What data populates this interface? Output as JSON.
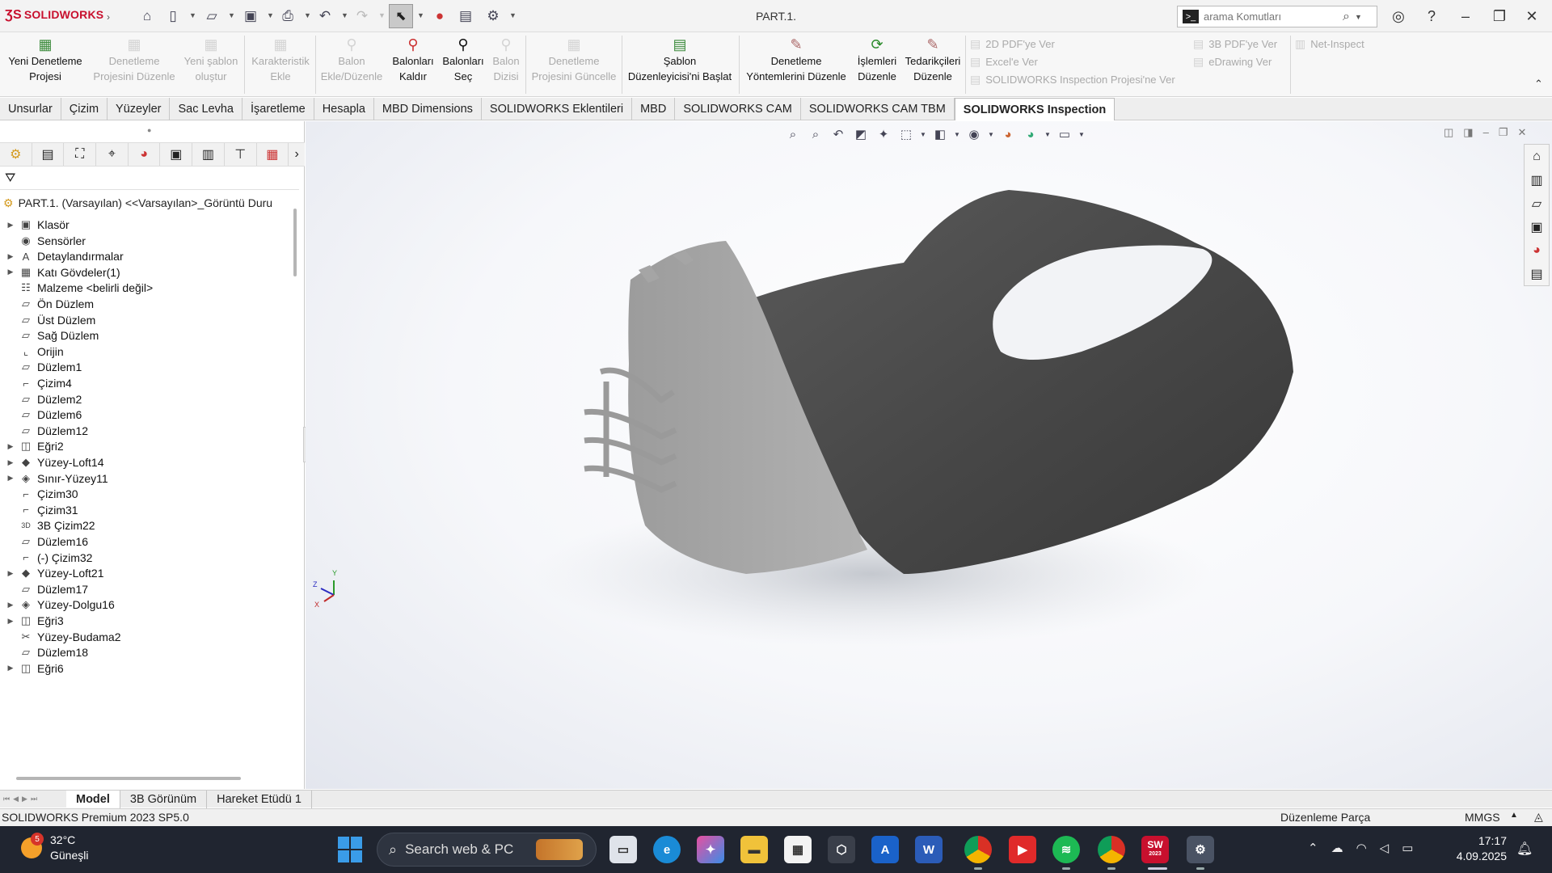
{
  "app": {
    "brand": "SOLIDWORKS",
    "doc_title": "PART.1.",
    "search_placeholder": "arama Komutları"
  },
  "ribbon": {
    "buttons": [
      {
        "label": "Yeni Denetleme Projesi",
        "l1": "Yeni Denetleme",
        "l2": "Projesi",
        "icon": "new-inspection-icon",
        "enabled": true
      },
      {
        "label": "Denetleme Projesini Düzenle",
        "l1": "Denetleme",
        "l2": "Projesini Düzenle",
        "icon": "edit-inspection-icon",
        "enabled": false
      },
      {
        "label": "Yeni şablon oluştur",
        "l1": "Yeni şablon",
        "l2": "oluştur",
        "icon": "new-template-icon",
        "enabled": false
      },
      {
        "label": "Karakteristik Ekle",
        "l1": "Karakteristik",
        "l2": "Ekle",
        "icon": "add-characteristic-icon",
        "enabled": false
      },
      {
        "label": "Balon Ekle/Düzenle",
        "l1": "Balon",
        "l2": "Ekle/Düzenle",
        "icon": "balloon-icon",
        "enabled": false
      },
      {
        "label": "Balonları Kaldır",
        "l1": "Balonları",
        "l2": "Kaldır",
        "icon": "remove-balloons-icon",
        "enabled": true
      },
      {
        "label": "Balonları Seç",
        "l1": "Balonları",
        "l2": "Seç",
        "icon": "select-balloons-icon",
        "enabled": true
      },
      {
        "label": "Balon Dizisi",
        "l1": "Balon",
        "l2": "Dizisi",
        "icon": "balloon-sequence-icon",
        "enabled": false
      },
      {
        "label": "Denetleme Projesini Güncelle",
        "l1": "Denetleme",
        "l2": "Projesini Güncelle",
        "icon": "update-inspection-icon",
        "enabled": false
      },
      {
        "label": "Şablon Düzenleyicisi'ni Başlat",
        "l1": "Şablon",
        "l2": "Düzenleyicisi'ni Başlat",
        "icon": "template-editor-icon",
        "enabled": true
      },
      {
        "label": "Denetleme Yöntemlerini Düzenle",
        "l1": "Denetleme",
        "l2": "Yöntemlerini Düzenle",
        "icon": "inspection-methods-icon",
        "enabled": true
      },
      {
        "label": "İşlemleri Düzenle",
        "l1": "İşlemleri",
        "l2": "Düzenle",
        "icon": "operations-icon",
        "enabled": true
      },
      {
        "label": "Tedarikçileri Düzenle",
        "l1": "Tedarikçileri",
        "l2": "Düzenle",
        "icon": "vendors-icon",
        "enabled": true
      }
    ],
    "exports_col1": [
      "2D PDF'ye Ver",
      "Excel'e Ver",
      "SOLIDWORKS Inspection Projesi'ne Ver"
    ],
    "exports_col2": [
      "3B PDF'ye Ver",
      "eDrawing Ver"
    ],
    "exports_col3": [
      "Net-Inspect"
    ]
  },
  "tabs": [
    {
      "label": "Unsurlar",
      "active": false
    },
    {
      "label": "Çizim",
      "active": false
    },
    {
      "label": "Yüzeyler",
      "active": false
    },
    {
      "label": "Sac Levha",
      "active": false
    },
    {
      "label": "İşaretleme",
      "active": false
    },
    {
      "label": "Hesapla",
      "active": false
    },
    {
      "label": "MBD Dimensions",
      "active": false
    },
    {
      "label": "SOLIDWORKS Eklentileri",
      "active": false
    },
    {
      "label": "MBD",
      "active": false
    },
    {
      "label": "SOLIDWORKS CAM",
      "active": false
    },
    {
      "label": "SOLIDWORKS CAM TBM",
      "active": false
    },
    {
      "label": "SOLIDWORKS Inspection",
      "active": true
    }
  ],
  "tree": {
    "root": "PART.1. (Varsayılan) <<Varsayılan>_Görüntü Duru",
    "items": [
      {
        "label": "Klasör",
        "expandable": true,
        "icon": "folder-icon"
      },
      {
        "label": "Sensörler",
        "expandable": false,
        "icon": "sensor-icon"
      },
      {
        "label": "Detaylandırmalar",
        "expandable": true,
        "icon": "annotation-icon"
      },
      {
        "label": "Katı Gövdeler(1)",
        "expandable": true,
        "icon": "solid-body-icon"
      },
      {
        "label": "Malzeme <belirli değil>",
        "expandable": false,
        "icon": "material-icon"
      },
      {
        "label": "Ön Düzlem",
        "expandable": false,
        "icon": "plane-icon"
      },
      {
        "label": "Üst Düzlem",
        "expandable": false,
        "icon": "plane-icon"
      },
      {
        "label": "Sağ Düzlem",
        "expandable": false,
        "icon": "plane-icon"
      },
      {
        "label": "Orijin",
        "expandable": false,
        "icon": "origin-icon"
      },
      {
        "label": "Düzlem1",
        "expandable": false,
        "icon": "plane-icon"
      },
      {
        "label": "Çizim4",
        "expandable": false,
        "icon": "sketch-icon"
      },
      {
        "label": "Düzlem2",
        "expandable": false,
        "icon": "plane-icon"
      },
      {
        "label": "Düzlem6",
        "expandable": false,
        "icon": "plane-icon"
      },
      {
        "label": "Düzlem12",
        "expandable": false,
        "icon": "plane-icon"
      },
      {
        "label": "Eğri2",
        "expandable": true,
        "icon": "curve-icon"
      },
      {
        "label": "Yüzey-Loft14",
        "expandable": true,
        "icon": "surface-loft-icon"
      },
      {
        "label": "Sınır-Yüzey11",
        "expandable": true,
        "icon": "boundary-surface-icon"
      },
      {
        "label": "Çizim30",
        "expandable": false,
        "icon": "sketch-icon"
      },
      {
        "label": "Çizim31",
        "expandable": false,
        "icon": "sketch-icon"
      },
      {
        "label": "3B Çizim22",
        "expandable": false,
        "icon": "3d-sketch-icon"
      },
      {
        "label": "Düzlem16",
        "expandable": false,
        "icon": "plane-icon"
      },
      {
        "label": "(-) Çizim32",
        "expandable": false,
        "icon": "sketch-icon"
      },
      {
        "label": "Yüzey-Loft21",
        "expandable": true,
        "icon": "surface-loft-icon"
      },
      {
        "label": "Düzlem17",
        "expandable": false,
        "icon": "plane-icon"
      },
      {
        "label": "Yüzey-Dolgu16",
        "expandable": true,
        "icon": "surface-fill-icon"
      },
      {
        "label": "Eğri3",
        "expandable": true,
        "icon": "curve-icon"
      },
      {
        "label": "Yüzey-Budama2",
        "expandable": false,
        "icon": "surface-trim-icon"
      },
      {
        "label": "Düzlem18",
        "expandable": false,
        "icon": "plane-icon"
      },
      {
        "label": "Eğri6",
        "expandable": true,
        "icon": "curve-icon"
      }
    ]
  },
  "model_tabs": [
    {
      "label": "Model",
      "active": true
    },
    {
      "label": "3B Görünüm",
      "active": false
    },
    {
      "label": "Hareket Etüdü 1",
      "active": false
    }
  ],
  "status": {
    "product": "SOLIDWORKS Premium 2023 SP5.0",
    "mode": "Düzenleme Parça",
    "units": "MMGS"
  },
  "triad": {
    "x": "X",
    "y": "Y",
    "z": "Z"
  },
  "taskbar": {
    "weather_badge": "5",
    "temp": "32°C",
    "condition": "Güneşli",
    "search": "Search web & PC",
    "time": "17:17",
    "date": "4.09.2025",
    "sw_badge": "2023"
  },
  "colors": {
    "brand_red": "#c8102e",
    "part_dark": "#4a4a4a",
    "part_light": "#a9a9a9",
    "taskbar": "#202530"
  }
}
